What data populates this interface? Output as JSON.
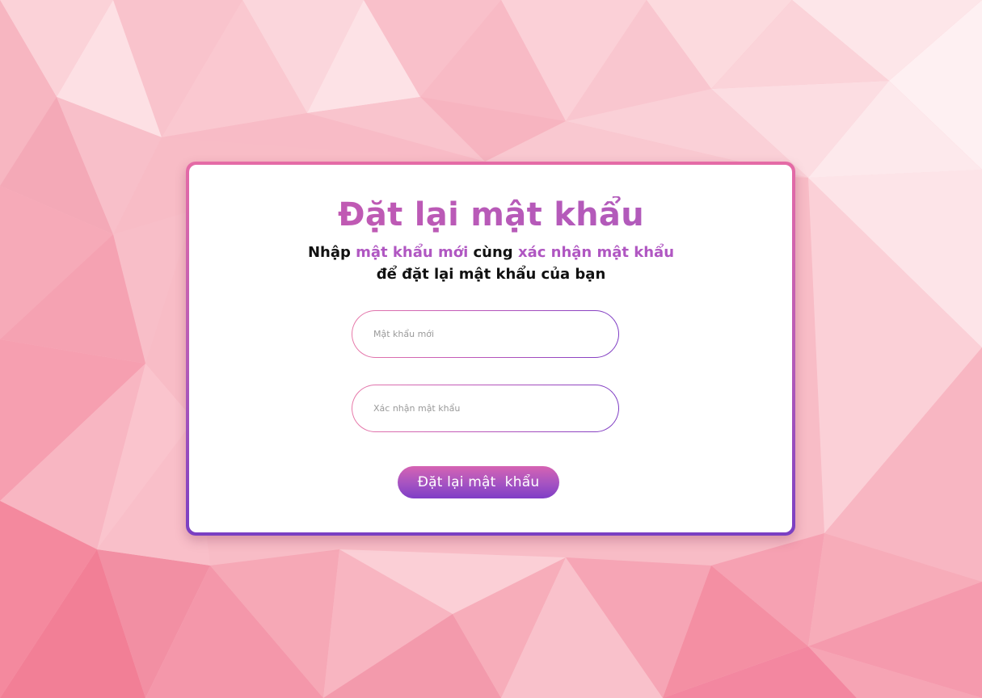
{
  "colors": {
    "background": "#f8bcc6",
    "accent": "#b057c2",
    "title": "#c25bb0",
    "button_start": "#d663b2",
    "button_end": "#7f3dc6",
    "text": "#111111"
  },
  "page": {
    "title": "Đặt lại mật khẩu",
    "subtitle": {
      "part1": "Nhập ",
      "highlight1": "mật khẩu mới",
      "part2": " cùng ",
      "highlight2": "xác nhận mật khẩu",
      "line2": "để đặt lại mật khẩu của bạn"
    }
  },
  "form": {
    "new_password": {
      "placeholder": "Mật khẩu mới",
      "value": ""
    },
    "confirm_password": {
      "placeholder": "Xác nhận mật khẩu",
      "value": ""
    },
    "submit_label": "Đặt lại mật  khẩu"
  }
}
